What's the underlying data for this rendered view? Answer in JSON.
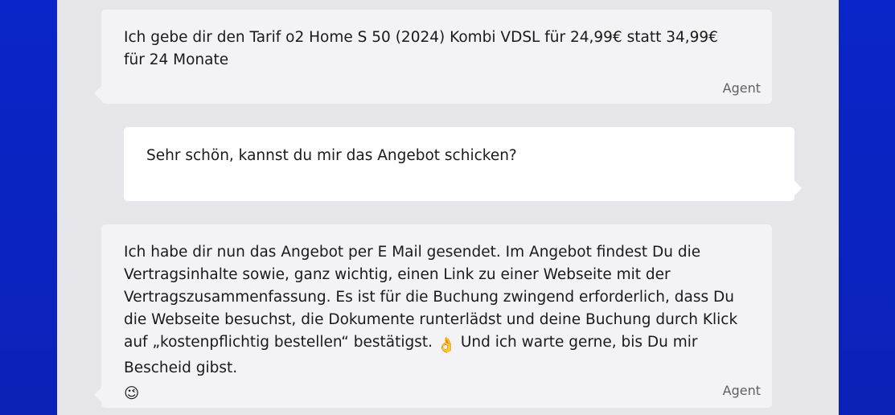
{
  "messages": [
    {
      "role": "agent",
      "text": "Ich gebe dir den Tarif o2 Home S 50 (2024) Kombi VDSL für 24,99€ statt 34,99€ für 24 Monate",
      "sender": "Agent"
    },
    {
      "role": "user",
      "text": "Sehr schön, kannst du mir das Angebot schicken?"
    },
    {
      "role": "agent",
      "text_part1": "Ich habe dir nun das Angebot per E Mail gesendet. Im Angebot findest Du die Vertragsinhalte sowie, ganz wichtig, einen Link zu einer Webseite mit der Vertragszusammenfassung. Es ist für die Buchung zwingend erforderlich, dass Du die Webseite besuchst, die Dokumente runterlädst und deine Buchung durch Klick auf „kostenpflichtig bestellen“ bestätigst. ",
      "emoji_ok": "👌",
      "text_part2": " Und ich warte gerne, bis Du mir Bescheid gibst. ",
      "emoji_wink": "😉",
      "sender": "Agent"
    }
  ],
  "colors": {
    "background_blue": "#0a25c9",
    "panel_gray": "#e6e6ea",
    "agent_bubble": "#f3f3f5",
    "user_bubble": "#ffffff"
  }
}
